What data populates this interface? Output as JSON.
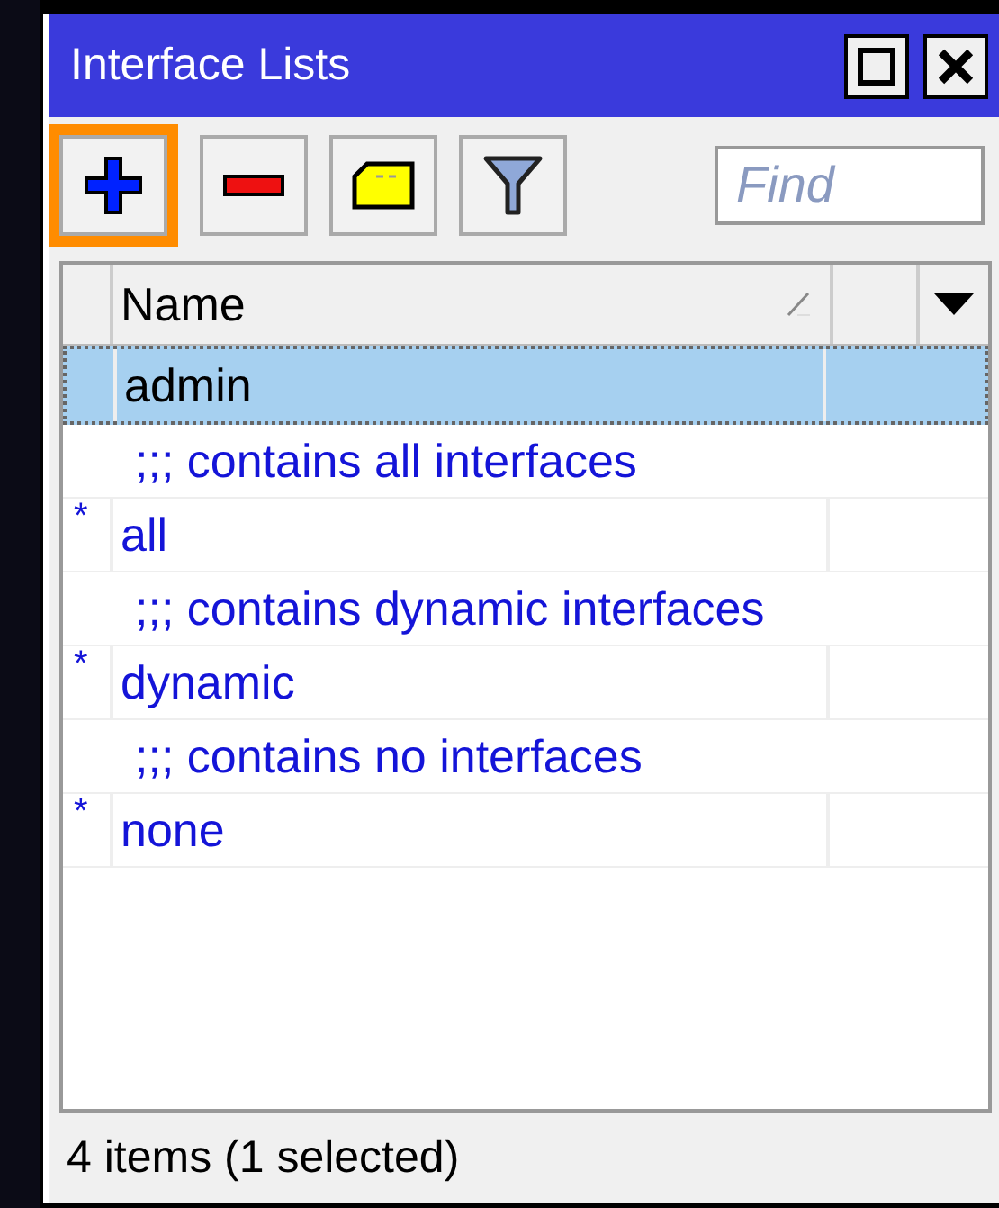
{
  "window": {
    "title": "Interface Lists"
  },
  "toolbar": {
    "buttons": [
      {
        "kind": "add",
        "highlighted": true
      },
      {
        "kind": "remove",
        "highlighted": false
      },
      {
        "kind": "comment",
        "highlighted": false
      },
      {
        "kind": "filter",
        "highlighted": false
      }
    ],
    "search": {
      "placeholder": "Find"
    }
  },
  "table": {
    "columns": [
      "Name"
    ],
    "rows": [
      {
        "flag": "",
        "name": "admin",
        "comment": "",
        "selected": true
      },
      {
        "flag": "*",
        "name": "all",
        "comment": ";;; contains all interfaces",
        "selected": false
      },
      {
        "flag": "*",
        "name": "dynamic",
        "comment": ";;; contains dynamic interfaces",
        "selected": false
      },
      {
        "flag": "*",
        "name": "none",
        "comment": ";;; contains no interfaces",
        "selected": false
      }
    ]
  },
  "status_bar": "4 items (1 selected)"
}
